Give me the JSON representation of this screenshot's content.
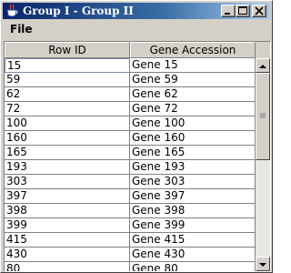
{
  "window": {
    "title": "Group I - Group II",
    "buttons": [
      "minimize",
      "maximize",
      "close"
    ]
  },
  "menu": {
    "items": [
      "File"
    ]
  },
  "table": {
    "columns": [
      "Row ID",
      "Gene Accession"
    ],
    "rows": [
      [
        "15",
        "Gene 15"
      ],
      [
        "59",
        "Gene 59"
      ],
      [
        "62",
        "Gene 62"
      ],
      [
        "72",
        "Gene 72"
      ],
      [
        "100",
        "Gene 100"
      ],
      [
        "160",
        "Gene 160"
      ],
      [
        "165",
        "Gene 165"
      ],
      [
        "193",
        "Gene 193"
      ],
      [
        "303",
        "Gene 303"
      ],
      [
        "397",
        "Gene 397"
      ],
      [
        "398",
        "Gene 398"
      ],
      [
        "399",
        "Gene 399"
      ],
      [
        "415",
        "Gene 415"
      ],
      [
        "430",
        "Gene 430"
      ],
      [
        "80",
        "Gene 80"
      ]
    ],
    "selected_row": 0
  },
  "colors": {
    "titlebar_start": "#0a246a",
    "titlebar_end": "#a6caf0",
    "window_bg": "#d4d0c8"
  },
  "icons": {
    "title": "java-coffee-cup-icon",
    "minimize": "minimize-icon",
    "maximize": "maximize-icon",
    "close": "close-icon",
    "scroll_up": "arrow-up-icon",
    "scroll_down": "arrow-down-icon"
  }
}
